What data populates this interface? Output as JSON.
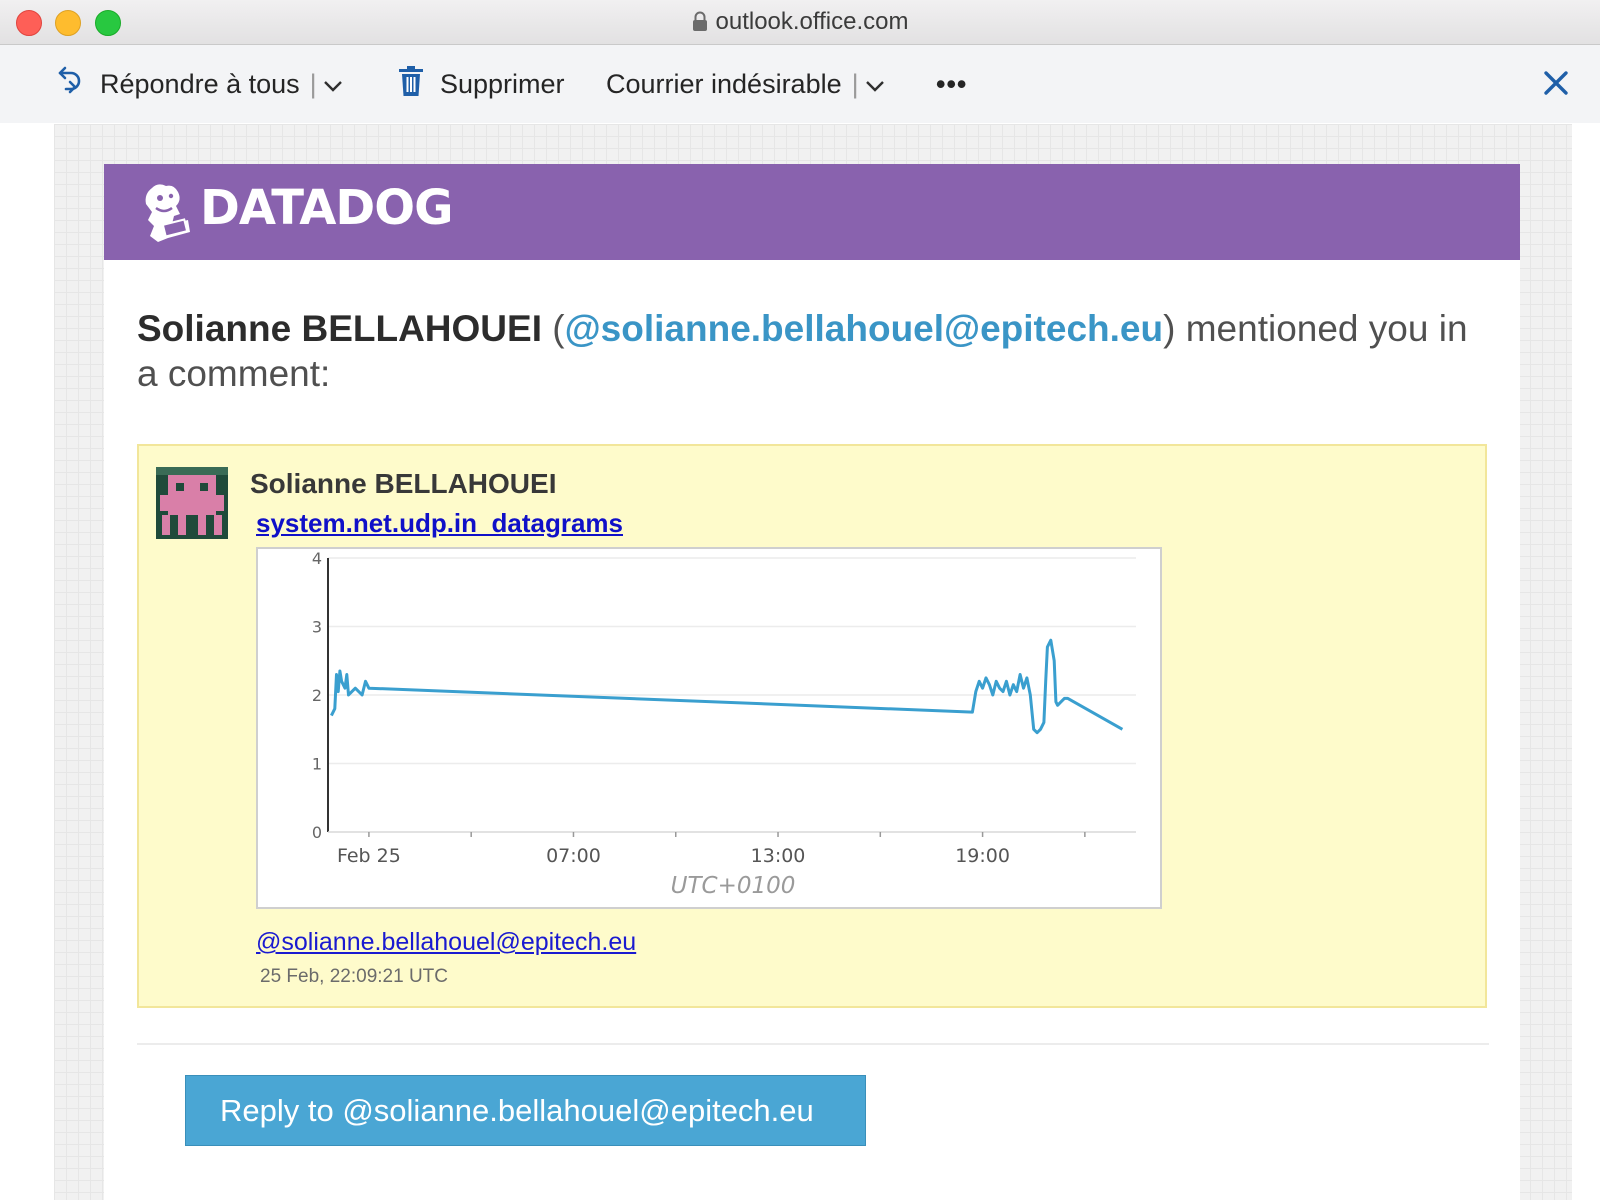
{
  "window": {
    "url": "outlook.office.com"
  },
  "toolbar": {
    "reply_all": "Répondre à tous",
    "delete": "Supprimer",
    "junk": "Courrier indésirable",
    "more": "•••"
  },
  "email": {
    "brand": "DATADOG",
    "brand_color": "#8962ae",
    "headline": {
      "name": "Solianne BELLAHOUEI",
      "handle": "@solianne.bellahouel@epitech.eu",
      "rest": "mentioned you in a comment:"
    },
    "comment": {
      "author": "Solianne BELLAHOUEI",
      "metric": "system.net.udp.in_datagrams",
      "handle": "@solianne.bellahouel@epitech.eu",
      "timestamp": "25 Feb, 22:09:21 UTC"
    },
    "reply_button": "Reply to @solianne.bellahouel@epitech.eu"
  },
  "chart_data": {
    "type": "line",
    "ylim": [
      0,
      4
    ],
    "yticks": [
      "0",
      "1",
      "2",
      "3",
      "4"
    ],
    "xticks": [
      "Feb 25",
      "07:00",
      "13:00",
      "19:00"
    ],
    "xlabel": "UTC+0100",
    "line_color": "#3a9fcf",
    "x_hours": [
      -0.1,
      0,
      0.05,
      0.1,
      0.15,
      0.2,
      0.3,
      0.35,
      0.4,
      0.5,
      0.6,
      0.7,
      0.8,
      0.9,
      1.0,
      18.7,
      18.8,
      18.9,
      19.0,
      19.1,
      19.2,
      19.3,
      19.4,
      19.5,
      19.6,
      19.7,
      19.8,
      19.9,
      20.0,
      20.1,
      20.2,
      20.3,
      20.4,
      20.5,
      20.6,
      20.7,
      20.8,
      20.85,
      20.9,
      21.0,
      21.1,
      21.15,
      21.2,
      21.3,
      21.4,
      21.5,
      23.1
    ],
    "y": [
      1.7,
      1.8,
      2.3,
      2.05,
      2.35,
      2.2,
      2.1,
      2.3,
      2.0,
      2.05,
      2.1,
      2.05,
      2.0,
      2.2,
      2.1,
      1.75,
      2.05,
      2.2,
      2.1,
      2.25,
      2.15,
      2.0,
      2.2,
      2.1,
      2.05,
      2.2,
      2.0,
      2.15,
      2.05,
      2.3,
      2.1,
      2.25,
      2.0,
      1.5,
      1.45,
      1.5,
      1.6,
      2.2,
      2.7,
      2.8,
      2.5,
      1.9,
      1.85,
      1.9,
      1.95,
      1.95,
      1.5
    ]
  }
}
